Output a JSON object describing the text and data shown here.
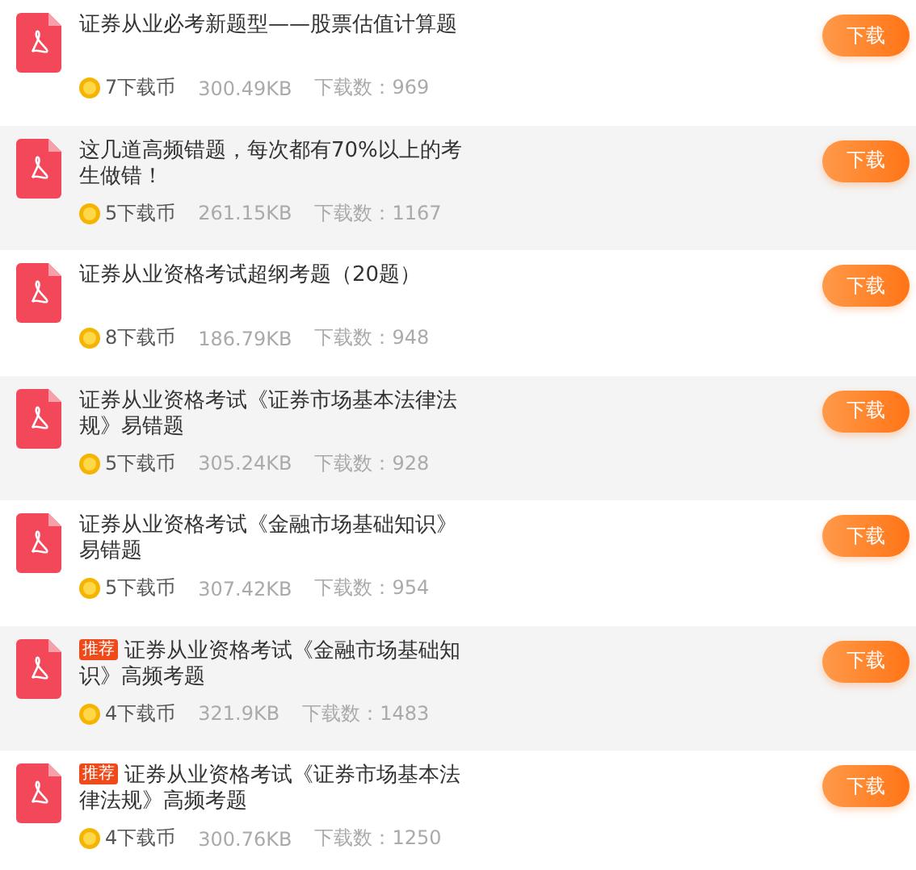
{
  "items": [
    {
      "title": "证券从业必考新题型——股票估值计算题",
      "coins": "7下载币",
      "size": "300.49KB",
      "downloads": "下载数：969",
      "button": "下载"
    },
    {
      "title": "这几道高频错题，每次都有70%以上的考生做错！",
      "coins": "5下载币",
      "size": "261.15KB",
      "downloads": "下载数：1167",
      "button": "下载"
    },
    {
      "title": "证券从业资格考试超纲考题（20题）",
      "coins": "8下载币",
      "size": "186.79KB",
      "downloads": "下载数：948",
      "button": "下载"
    },
    {
      "title": "证券从业资格考试《证券市场基本法律法规》易错题",
      "coins": "5下载币",
      "size": "305.24KB",
      "downloads": "下载数：928",
      "button": "下载"
    },
    {
      "title": "证券从业资格考试《金融市场基础知识》易错题",
      "coins": "5下载币",
      "size": "307.42KB",
      "downloads": "下载数：954",
      "button": "下载"
    },
    {
      "title": "证券从业资格考试《金融市场基础知识》高频考题",
      "badge": "推荐",
      "coins": "4下载币",
      "size": "321.9KB",
      "downloads": "下载数：1483",
      "button": "下载"
    },
    {
      "title": "证券从业资格考试《证券市场基本法律法规》高频考题",
      "badge": "推荐",
      "coins": "4下载币",
      "size": "300.76KB",
      "downloads": "下载数：1250",
      "button": "下载"
    }
  ]
}
